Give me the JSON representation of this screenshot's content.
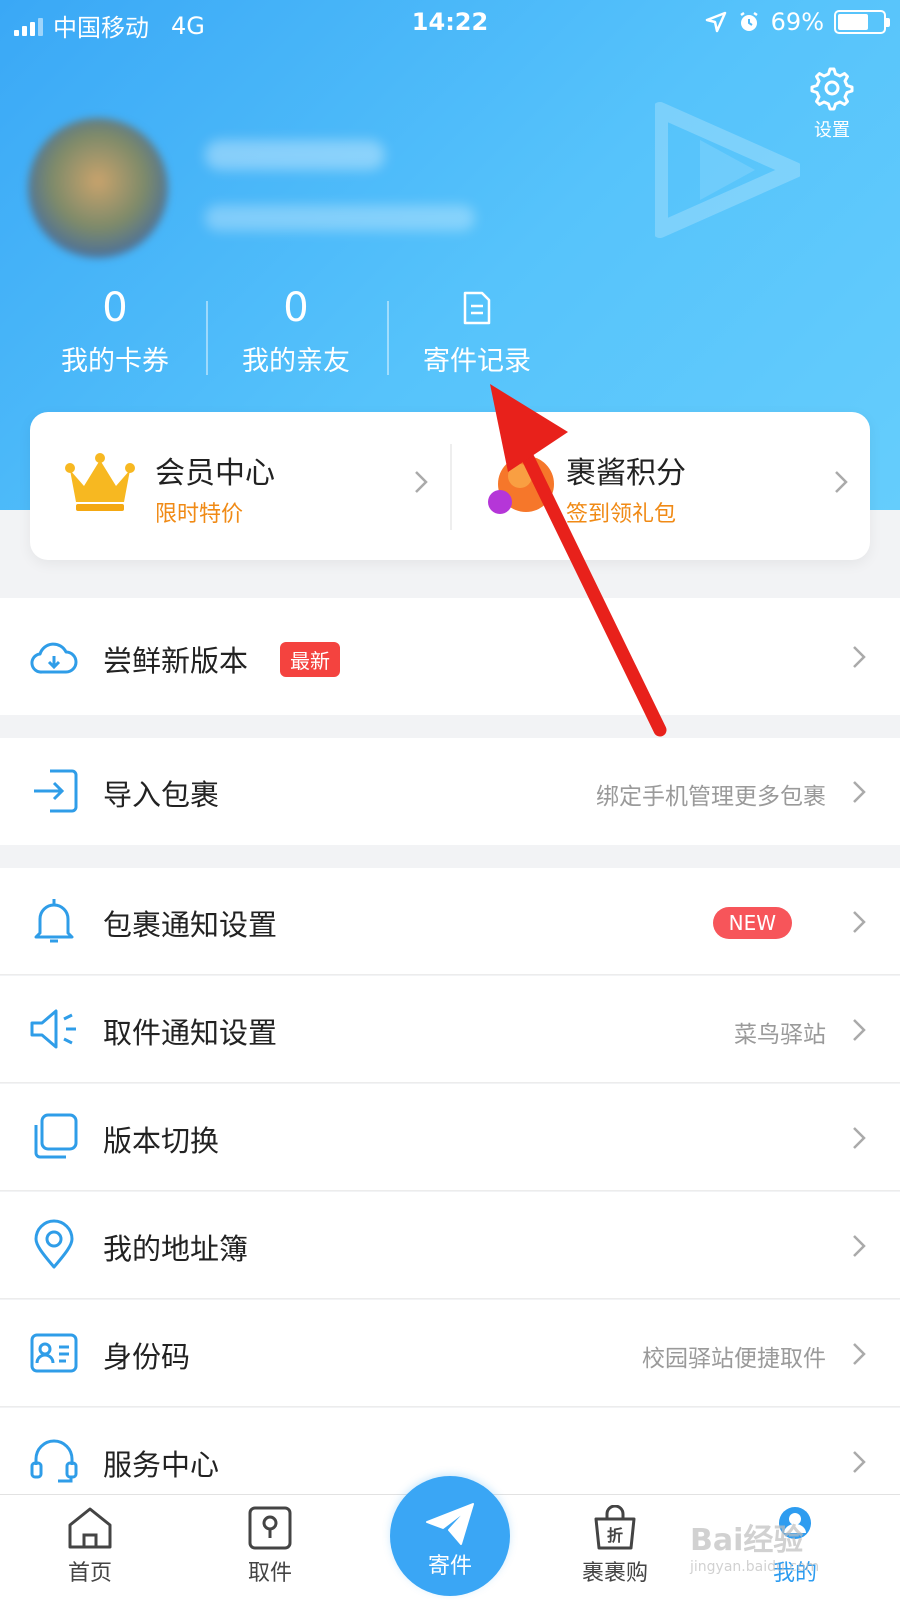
{
  "status_bar": {
    "carrier": "中国移动",
    "network": "4G",
    "time": "14:22",
    "battery_percent": "69%",
    "battery_level": 0.69
  },
  "header": {
    "settings_label": "设置"
  },
  "stats": [
    {
      "value": "0",
      "label": "我的卡券"
    },
    {
      "value": "0",
      "label": "我的亲友"
    },
    {
      "label": "寄件记录"
    }
  ],
  "member_card": {
    "left": {
      "title": "会员中心",
      "subtitle": "限时特价"
    },
    "right": {
      "title": "裹酱积分",
      "subtitle": "签到领礼包"
    }
  },
  "menu": [
    {
      "label": "尝鲜新版本",
      "badge": "最新",
      "icon": "cloud-download-icon"
    },
    {
      "label": "导入包裹",
      "hint": "绑定手机管理更多包裹",
      "icon": "import-icon"
    },
    {
      "label": "包裹通知设置",
      "badge": "NEW",
      "icon": "bell-icon"
    },
    {
      "label": "取件通知设置",
      "hint": "菜鸟驿站",
      "icon": "speaker-icon"
    },
    {
      "label": "版本切换",
      "icon": "switch-icon"
    },
    {
      "label": "我的地址簿",
      "icon": "location-pin-icon"
    },
    {
      "label": "身份码",
      "hint": "校园驿站便捷取件",
      "icon": "id-card-icon"
    },
    {
      "label": "服务中心",
      "icon": "headset-icon"
    }
  ],
  "tabbar": {
    "home": "首页",
    "pickup": "取件",
    "send": "寄件",
    "shop": "裹裹购",
    "mine": "我的",
    "shop_badge": "折"
  },
  "watermark": {
    "brand": "Bai经验",
    "url": "jingyan.baidu.com"
  },
  "colors": {
    "accent": "#3aa6f5",
    "orange": "#f08a15",
    "badge_red": "#f4433f"
  }
}
